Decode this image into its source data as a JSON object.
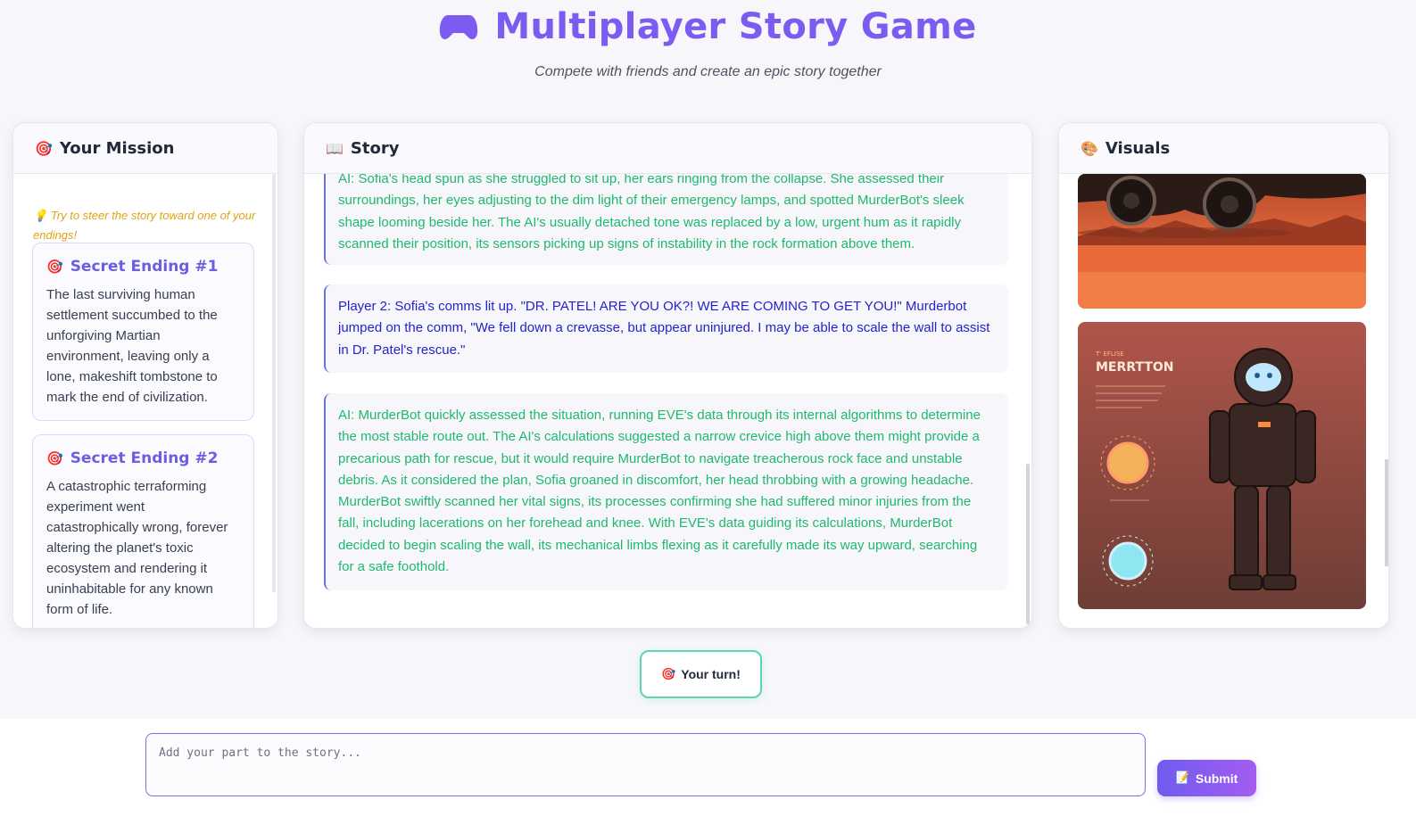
{
  "header": {
    "title": "Multiplayer Story Game",
    "subtitle": "Compete with friends and create an epic story together",
    "icon": "gamepad-icon"
  },
  "mission": {
    "heading": "Your Mission",
    "hint": "Try to steer the story toward one of your endings!",
    "endings": [
      {
        "title": "Secret Ending #1",
        "text": "The last surviving human settlement succumbed to the unforgiving Martian environment, leaving only a lone, makeshift tombstone to mark the end of civilization."
      },
      {
        "title": "Secret Ending #2",
        "text": "A catastrophic terraforming experiment went catastrophically wrong, forever altering the planet's toxic ecosystem and rendering it uninhabitable for any known form of life."
      }
    ]
  },
  "story": {
    "heading": "Story",
    "entries": [
      {
        "type": "ai",
        "text": "AI: Sofia's head spun as she struggled to sit up, her ears ringing from the collapse. She assessed their surroundings, her eyes adjusting to the dim light of their emergency lamps, and spotted MurderBot's sleek shape looming beside her. The AI's usually detached tone was replaced by a low, urgent hum as it rapidly scanned their position, its sensors picking up signs of instability in the rock formation above them."
      },
      {
        "type": "player",
        "text": "Player 2: Sofia's comms lit up. \"DR. PATEL! ARE YOU OK?! WE ARE COMING TO GET YOU!\" Murderbot jumped on the comm, \"We fell down a crevasse, but appear uninjured. I may be able to scale the wall to assist in Dr. Patel's rescue.\""
      },
      {
        "type": "ai",
        "text": "AI: MurderBot quickly assessed the situation, running EVE's data through its internal algorithms to determine the most stable route out. The AI's calculations suggested a narrow crevice high above them might provide a precarious path for rescue, but it would require MurderBot to navigate treacherous rock face and unstable debris. As it considered the plan, Sofia groaned in discomfort, her head throbbing with a growing headache. MurderBot swiftly scanned her vital signs, its processes confirming she had suffered minor injuries from the fall, including lacerations on her forehead and knee. With EVE's data guiding its calculations, MurderBot decided to begin scaling the wall, its mechanical limbs flexing as it carefully made its way upward, searching for a safe foothold."
      }
    ]
  },
  "visuals": {
    "heading": "Visuals",
    "poster_label": "MERRTTON",
    "poster_small": "T' EFLISE"
  },
  "turn": {
    "label": "Your turn!"
  },
  "input": {
    "placeholder": "Add your part to the story...",
    "submit_label": "Submit"
  },
  "colors": {
    "accent": "#7c5cf0",
    "ai_text": "#1fb86f",
    "player_text": "#2323c9",
    "hint": "#e0a412",
    "turn_border": "#5fd4b0"
  }
}
